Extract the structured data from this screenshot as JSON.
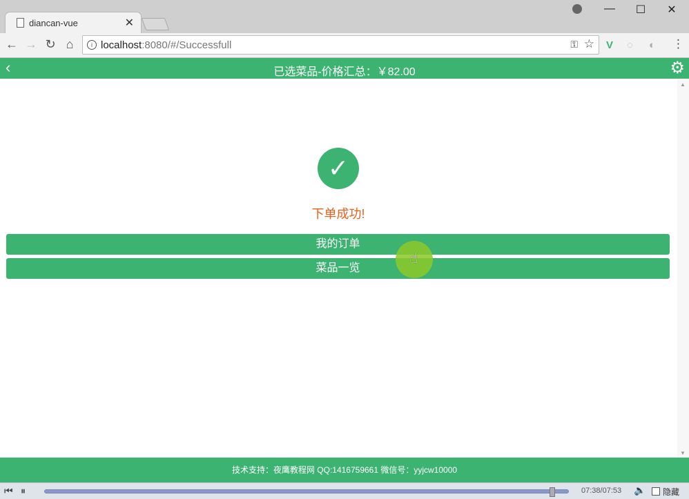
{
  "browser": {
    "tab_title": "diancan-vue",
    "tab_close": "✕",
    "url_host": "localhost",
    "url_rest": ":8080/#/Successfull",
    "window_controls": {
      "minimize": "—",
      "maximize": "☐",
      "close": "✕"
    },
    "nav": {
      "back": "←",
      "forward": "→",
      "reload": "↻",
      "home": "⌂"
    },
    "icons": {
      "info": "i",
      "key": "⚿",
      "star": "☆",
      "menu": "⋮",
      "vue_ext": "V",
      "ext2": "◌",
      "ext3": "◐"
    }
  },
  "header": {
    "back": "‹",
    "title": "已选菜品-价格汇总：￥82.00",
    "gear": "⚙"
  },
  "content": {
    "check_glyph": "✓",
    "success_text": "下单成功!",
    "buttons": [
      {
        "label": "我的订单"
      },
      {
        "label": "菜品一览"
      }
    ]
  },
  "footer": {
    "text": "技术支持：夜鹰教程网 QQ:1416759661 微信号：yyjcw10000"
  },
  "player": {
    "prev": "⏮",
    "pause": "⏸",
    "time": "07:38/07:53",
    "progress_fraction": 0.972,
    "volume": "🔈",
    "hide_label": "隐藏"
  },
  "colors": {
    "accent": "#3cb371",
    "success_text": "#e8601c"
  }
}
